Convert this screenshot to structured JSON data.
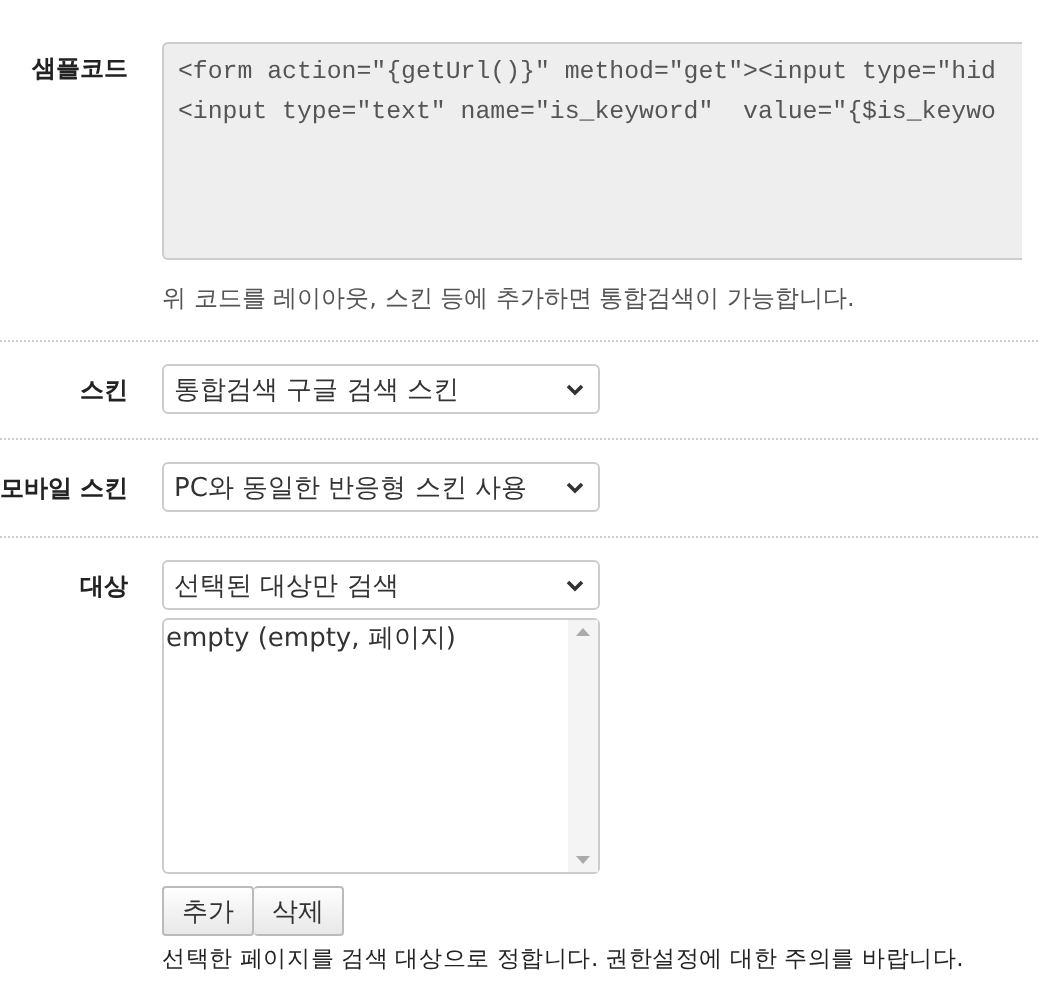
{
  "sample_code": {
    "label": "샘플코드",
    "lines": [
      "<form action=\"{getUrl()}\" method=\"get\"><input type=\"hid",
      "<input type=\"text\" name=\"is_keyword\"  value=\"{$is_keywo"
    ],
    "help": "위 코드를 레이아웃, 스킨 등에 추가하면 통합검색이 가능합니다."
  },
  "fields": [
    {
      "label": "스킨",
      "value": "통합검색 구글 검색 스킨"
    },
    {
      "label": "모바일 스킨",
      "value": "PC와 동일한 반응형 스킨 사용"
    }
  ],
  "target": {
    "label": "대상",
    "value": "선택된 대상만 검색",
    "items": [
      "empty (empty, 페이지)"
    ],
    "buttons": [
      "추가",
      "삭제"
    ],
    "help": "선택한 페이지를 검색 대상으로 정합니다. 권한설정에 대한 주의를 바랍니다."
  }
}
